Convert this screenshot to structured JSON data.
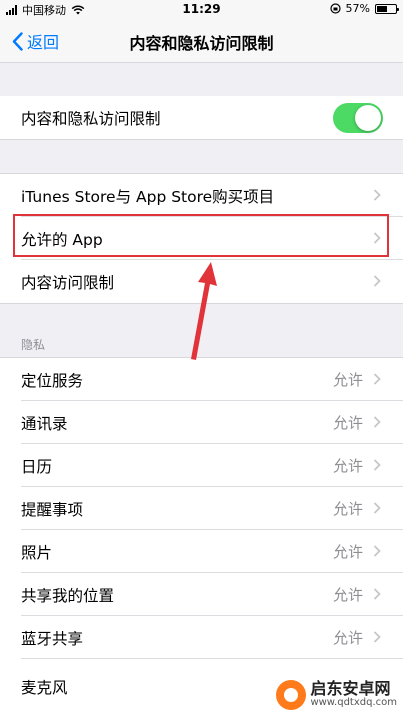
{
  "status_bar": {
    "carrier": "中国移动",
    "time": "11:29",
    "battery_percent": "57%",
    "battery_level": 0.57
  },
  "nav": {
    "back_label": "返回",
    "title": "内容和隐私访问限制"
  },
  "toggle_row": {
    "label": "内容和隐私访问限制",
    "enabled": true
  },
  "settings_rows": [
    {
      "label": "iTunes Store与 App Store购买项目"
    },
    {
      "label": "允许的 App"
    },
    {
      "label": "内容访问限制"
    }
  ],
  "privacy": {
    "header": "隐私",
    "rows": [
      {
        "label": "定位服务",
        "value": "允许"
      },
      {
        "label": "通讯录",
        "value": "允许"
      },
      {
        "label": "日历",
        "value": "允许"
      },
      {
        "label": "提醒事项",
        "value": "允许"
      },
      {
        "label": "照片",
        "value": "允许"
      },
      {
        "label": "共享我的位置",
        "value": "允许"
      },
      {
        "label": "蓝牙共享",
        "value": "允许"
      },
      {
        "label": "麦克风",
        "value": ""
      }
    ]
  },
  "watermark": {
    "main": "启东安卓网",
    "sub": "www.qdtxdq.com"
  },
  "colors": {
    "accent": "#007aff",
    "toggle_on": "#4cd964",
    "highlight": "#e0343a"
  }
}
